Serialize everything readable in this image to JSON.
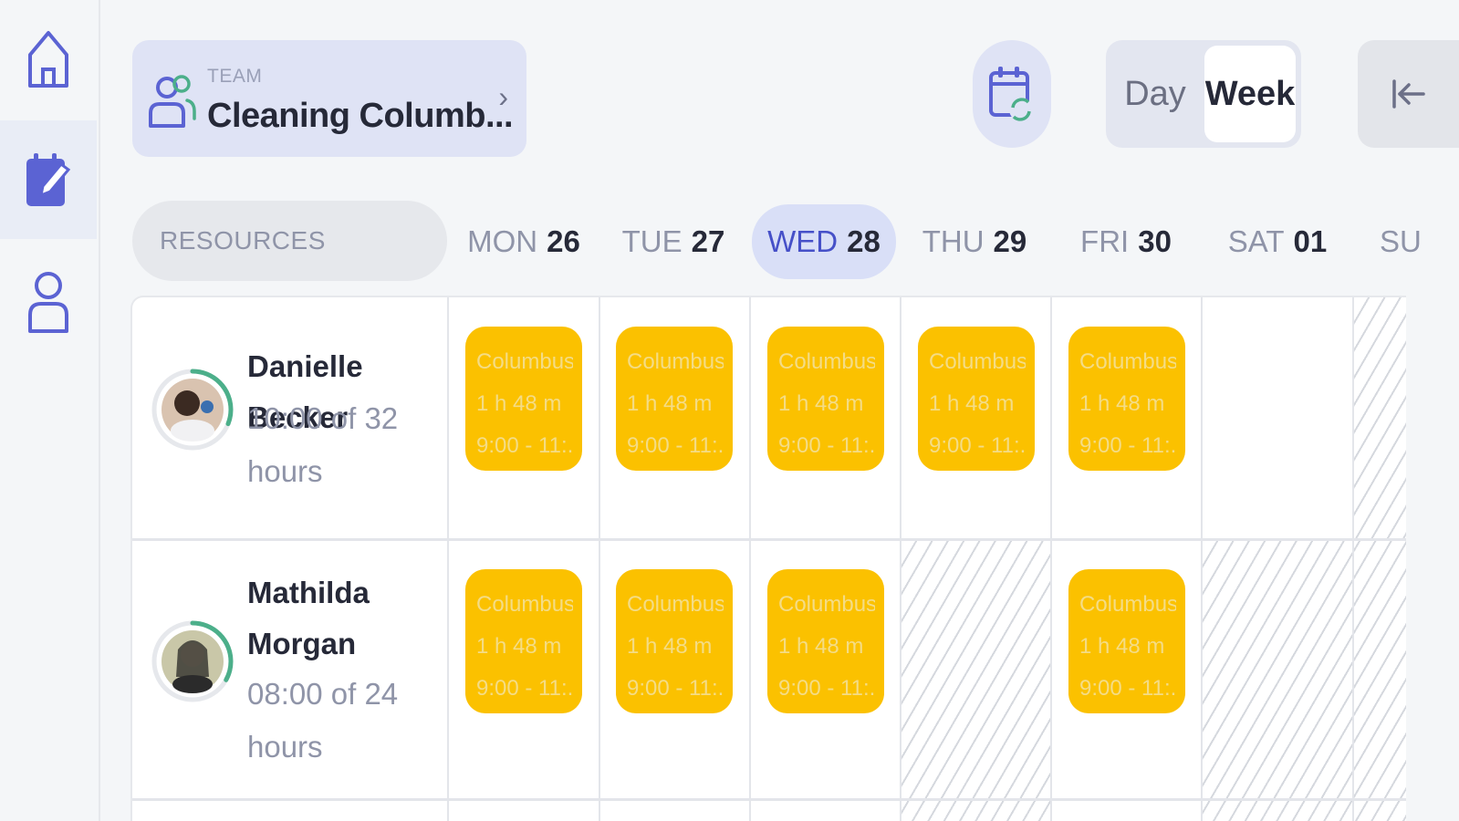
{
  "nav": {
    "items": [
      {
        "name": "home",
        "icon": "home-icon"
      },
      {
        "name": "schedule",
        "icon": "edit-calendar-icon",
        "active": true
      },
      {
        "name": "profile",
        "icon": "user-icon"
      }
    ]
  },
  "team": {
    "label": "TEAM",
    "name": "Cleaning Columb...",
    "icon": "team-icon"
  },
  "toolbar": {
    "refresh_icon": "calendar-refresh-icon",
    "day_label": "Day",
    "week_label": "Week",
    "active_view": "Week",
    "collapse_icon": "collapse-left-icon"
  },
  "resources_label": "RESOURCES",
  "days": [
    {
      "name": "MON",
      "num": "26"
    },
    {
      "name": "TUE",
      "num": "27"
    },
    {
      "name": "WED",
      "num": "28",
      "today": true
    },
    {
      "name": "THU",
      "num": "29"
    },
    {
      "name": "FRI",
      "num": "30"
    },
    {
      "name": "SAT",
      "num": "01"
    },
    {
      "name": "SU",
      "num": ""
    }
  ],
  "resources": [
    {
      "name": "Danielle Becker",
      "hours_line1": "10:00 of 32",
      "hours_line2": "hours",
      "progress": 0.31,
      "shifts": [
        {
          "title": "Columbus",
          "duration": "1 h 48 m",
          "time": "9:00 - 11:..."
        },
        {
          "title": "Columbus",
          "duration": "1 h 48 m",
          "time": "9:00 - 11:..."
        },
        {
          "title": "Columbus",
          "duration": "1 h 48 m",
          "time": "9:00 - 11:..."
        },
        {
          "title": "Columbus",
          "duration": "1 h 48 m",
          "time": "9:00 - 11:..."
        },
        {
          "title": "Columbus",
          "duration": "1 h 48 m",
          "time": "9:00 - 11:..."
        }
      ]
    },
    {
      "name_line1": "Mathilda",
      "name_line2": "Morgan",
      "hours_line1": "08:00 of 24",
      "hours_line2": "hours",
      "progress": 0.33,
      "shifts": [
        {
          "title": "Columbus",
          "duration": "1 h 48 m",
          "time": "9:00 - 11:..."
        },
        {
          "title": "Columbus",
          "duration": "1 h 48 m",
          "time": "9:00 - 11:..."
        },
        {
          "title": "Columbus",
          "duration": "1 h 48 m",
          "time": "9:00 - 11:..."
        },
        {
          "title": "Columbus",
          "duration": "1 h 48 m",
          "time": "9:00 - 11:..."
        }
      ]
    }
  ],
  "colors": {
    "accent": "#4650c8",
    "shift": "#fbc100",
    "progress": "#4caf8a"
  }
}
